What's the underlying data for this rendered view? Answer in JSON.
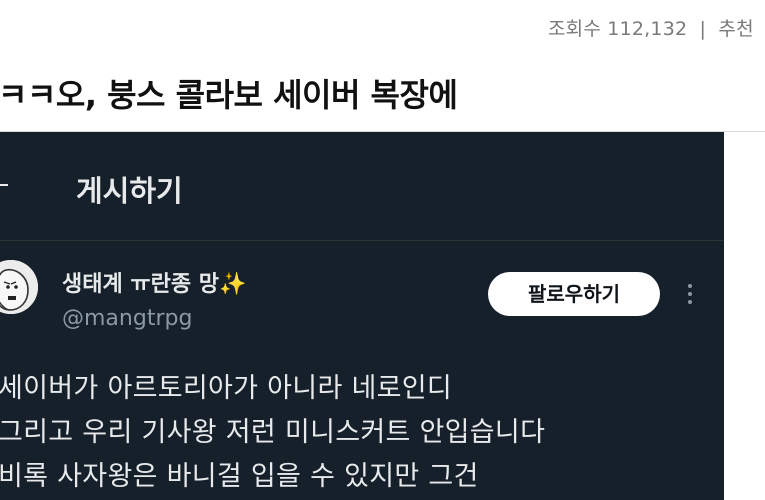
{
  "meta": {
    "views_label": "조회수",
    "views_count": "112,132",
    "separator": "|",
    "recommend_label": "추천"
  },
  "post": {
    "title": "ㅋㅋ오, 붕스 콜라보 세이버 복장에"
  },
  "screenshot": {
    "header_title": "게시하기",
    "author": {
      "display_name": "생태계 ㅠ란종 망",
      "sparkle": "✨",
      "handle": "@mangtrpg"
    },
    "follow_label": "팔로우하기",
    "lines": [
      "세이버가 아르토리아가 아니라 네로인디",
      "그리고 우리 기사왕 저런 미니스커트 안입습니다",
      "비록 사자왕은 바니걸 입을 수 있지만 그건"
    ]
  },
  "colors": {
    "dark_bg": "#15202b",
    "text_light": "#e7e9ea",
    "muted": "#8b98a5"
  }
}
